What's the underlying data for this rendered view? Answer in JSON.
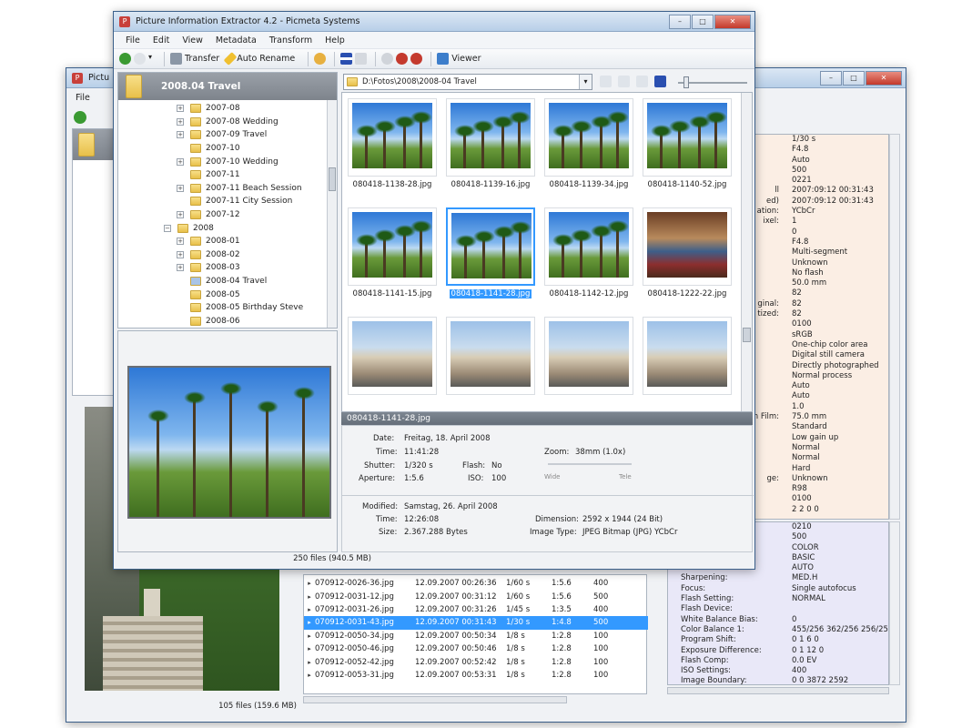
{
  "back_window": {
    "title": "Pictu",
    "menu_file": "File",
    "status": "105 files (159.6 MB)",
    "metadata_values_top": [
      "1/30 s",
      "F4.8",
      "Auto",
      "500",
      "0221",
      "2007:09:12 00:31:43",
      "2007:09:12 00:31:43",
      "YCbCr",
      "1",
      "0",
      "F4.8",
      "Multi-segment",
      "Unknown",
      "No flash",
      "50.0 mm",
      "82",
      "82",
      "82",
      "0100",
      "sRGB",
      "One-chip color area",
      "Digital still camera",
      "Directly photographed",
      "Normal process",
      "Auto",
      "Auto",
      "1.0",
      "75.0 mm",
      "Standard",
      "Low gain up",
      "Normal",
      "Normal",
      "Hard",
      "Unknown",
      "R98",
      "0100",
      "2 2 0 0"
    ],
    "metadata_keys_partial": [
      "ll",
      "ed)",
      "ation:",
      "ixel:",
      "ginal:",
      "tized:",
      "n Film:",
      "ge:"
    ],
    "maker_rows": [
      {
        "k": "",
        "v": "0210"
      },
      {
        "k": "",
        "v": "500"
      },
      {
        "k": "",
        "v": "COLOR"
      },
      {
        "k": "",
        "v": "BASIC"
      },
      {
        "k": "",
        "v": "AUTO"
      },
      {
        "k": "Sharpening:",
        "v": "MED.H"
      },
      {
        "k": "Focus:",
        "v": "Single autofocus"
      },
      {
        "k": "Flash Setting:",
        "v": "NORMAL"
      },
      {
        "k": "Flash Device:",
        "v": ""
      },
      {
        "k": "White Balance Bias:",
        "v": "0"
      },
      {
        "k": "Color Balance 1:",
        "v": "455/256 362/256 256/25"
      },
      {
        "k": "Program Shift:",
        "v": "0 1 6 0"
      },
      {
        "k": "Exposure Difference:",
        "v": "0 1 12 0"
      },
      {
        "k": "Flash Comp:",
        "v": "0.0 EV"
      },
      {
        "k": "ISO Settings:",
        "v": "400"
      },
      {
        "k": "Image Boundary:",
        "v": "0 0 3872 2592"
      }
    ],
    "files": [
      {
        "name": "070912-0026-36.jpg",
        "date": "12.09.2007 00:26:36",
        "exp": "1/60 s",
        "f": "1:5.6",
        "iso": "400",
        "sel": false
      },
      {
        "name": "070912-0031-12.jpg",
        "date": "12.09.2007 00:31:12",
        "exp": "1/60 s",
        "f": "1:5.6",
        "iso": "500",
        "sel": false
      },
      {
        "name": "070912-0031-26.jpg",
        "date": "12.09.2007 00:31:26",
        "exp": "1/45 s",
        "f": "1:3.5",
        "iso": "400",
        "sel": false
      },
      {
        "name": "070912-0031-43.jpg",
        "date": "12.09.2007 00:31:43",
        "exp": "1/30 s",
        "f": "1:4.8",
        "iso": "500",
        "sel": true
      },
      {
        "name": "070912-0050-34.jpg",
        "date": "12.09.2007 00:50:34",
        "exp": "1/8 s",
        "f": "1:2.8",
        "iso": "100",
        "sel": false
      },
      {
        "name": "070912-0050-46.jpg",
        "date": "12.09.2007 00:50:46",
        "exp": "1/8 s",
        "f": "1:2.8",
        "iso": "100",
        "sel": false
      },
      {
        "name": "070912-0052-42.jpg",
        "date": "12.09.2007 00:52:42",
        "exp": "1/8 s",
        "f": "1:2.8",
        "iso": "100",
        "sel": false
      },
      {
        "name": "070912-0053-31.jpg",
        "date": "12.09.2007 00:53:31",
        "exp": "1/8 s",
        "f": "1:2.8",
        "iso": "100",
        "sel": false
      }
    ]
  },
  "front_window": {
    "title": "Picture Information Extractor 4.2 - Picmeta Systems",
    "menu": [
      "File",
      "Edit",
      "View",
      "Metadata",
      "Transform",
      "Help"
    ],
    "toolbar": {
      "transfer": "Transfer",
      "auto_rename": "Auto Rename",
      "viewer": "Viewer"
    },
    "tree_header": "2008.04 Travel",
    "path": "D:\\Fotos\\2008\\2008-04 Travel",
    "tree": [
      {
        "label": "2007-08",
        "level": 2,
        "exp": true
      },
      {
        "label": "2007-08 Wedding",
        "level": 2,
        "exp": true
      },
      {
        "label": "2007-09 Travel",
        "level": 2,
        "exp": true
      },
      {
        "label": "2007-10",
        "level": 2,
        "exp": false
      },
      {
        "label": "2007-10 Wedding",
        "level": 2,
        "exp": true
      },
      {
        "label": "2007-11",
        "level": 2,
        "exp": false
      },
      {
        "label": "2007-11 Beach Session",
        "level": 2,
        "exp": true
      },
      {
        "label": "2007-11 City Session",
        "level": 2,
        "exp": false
      },
      {
        "label": "2007-12",
        "level": 2,
        "exp": true
      },
      {
        "label": "2008",
        "level": 1,
        "exp": true
      },
      {
        "label": "2008-01",
        "level": 2,
        "exp": true
      },
      {
        "label": "2008-02",
        "level": 2,
        "exp": true
      },
      {
        "label": "2008-03",
        "level": 2,
        "exp": true
      },
      {
        "label": "2008-04 Travel",
        "level": 2,
        "exp": false
      },
      {
        "label": "2008-05",
        "level": 2,
        "exp": false
      },
      {
        "label": "2008-05 Birthday Steve",
        "level": 2,
        "exp": false
      },
      {
        "label": "2008-06",
        "level": 2,
        "exp": false
      }
    ],
    "thumbs": [
      {
        "label": "080418-1138-28.jpg",
        "kind": "sky",
        "sel": false
      },
      {
        "label": "080418-1139-16.jpg",
        "kind": "sky",
        "sel": false
      },
      {
        "label": "080418-1139-34.jpg",
        "kind": "sky",
        "sel": false
      },
      {
        "label": "080418-1140-52.jpg",
        "kind": "sky",
        "sel": false
      },
      {
        "label": "080418-1141-15.jpg",
        "kind": "sky",
        "sel": false
      },
      {
        "label": "080418-1141-28.jpg",
        "kind": "sky",
        "sel": true
      },
      {
        "label": "080418-1142-12.jpg",
        "kind": "sky",
        "sel": false
      },
      {
        "label": "080418-1222-22.jpg",
        "kind": "int",
        "sel": false
      },
      {
        "label": "",
        "kind": "city",
        "sel": false
      },
      {
        "label": "",
        "kind": "city",
        "sel": false
      },
      {
        "label": "",
        "kind": "city",
        "sel": false
      },
      {
        "label": "",
        "kind": "city",
        "sel": false
      }
    ],
    "info": {
      "filename": "080418-1141-28.jpg",
      "date_label": "Date:",
      "date": "Freitag, 18. April 2008",
      "time_label": "Time:",
      "time": "11:41:28",
      "shutter_label": "Shutter:",
      "shutter": "1/320 s",
      "aperture_label": "Aperture:",
      "aperture": "1:5.6",
      "flash_label": "Flash:",
      "flash": "No",
      "iso_label": "ISO:",
      "iso": "100",
      "zoom_label": "Zoom:",
      "zoom": "38mm (1.0x)",
      "zoom_min": "Wide",
      "zoom_max": "Tele",
      "modified_label": "Modified:",
      "modified": "Samstag, 26. April 2008",
      "mtime_label": "Time:",
      "mtime": "12:26:08",
      "size_label": "Size:",
      "size": "2.367.288 Bytes",
      "dimension_label": "Dimension:",
      "dimension": "2592 x 1944 (24 Bit)",
      "imagetype_label": "Image Type:",
      "imagetype": "JPEG Bitmap (JPG) YCbCr"
    },
    "status": "250 files (940.5 MB)"
  }
}
